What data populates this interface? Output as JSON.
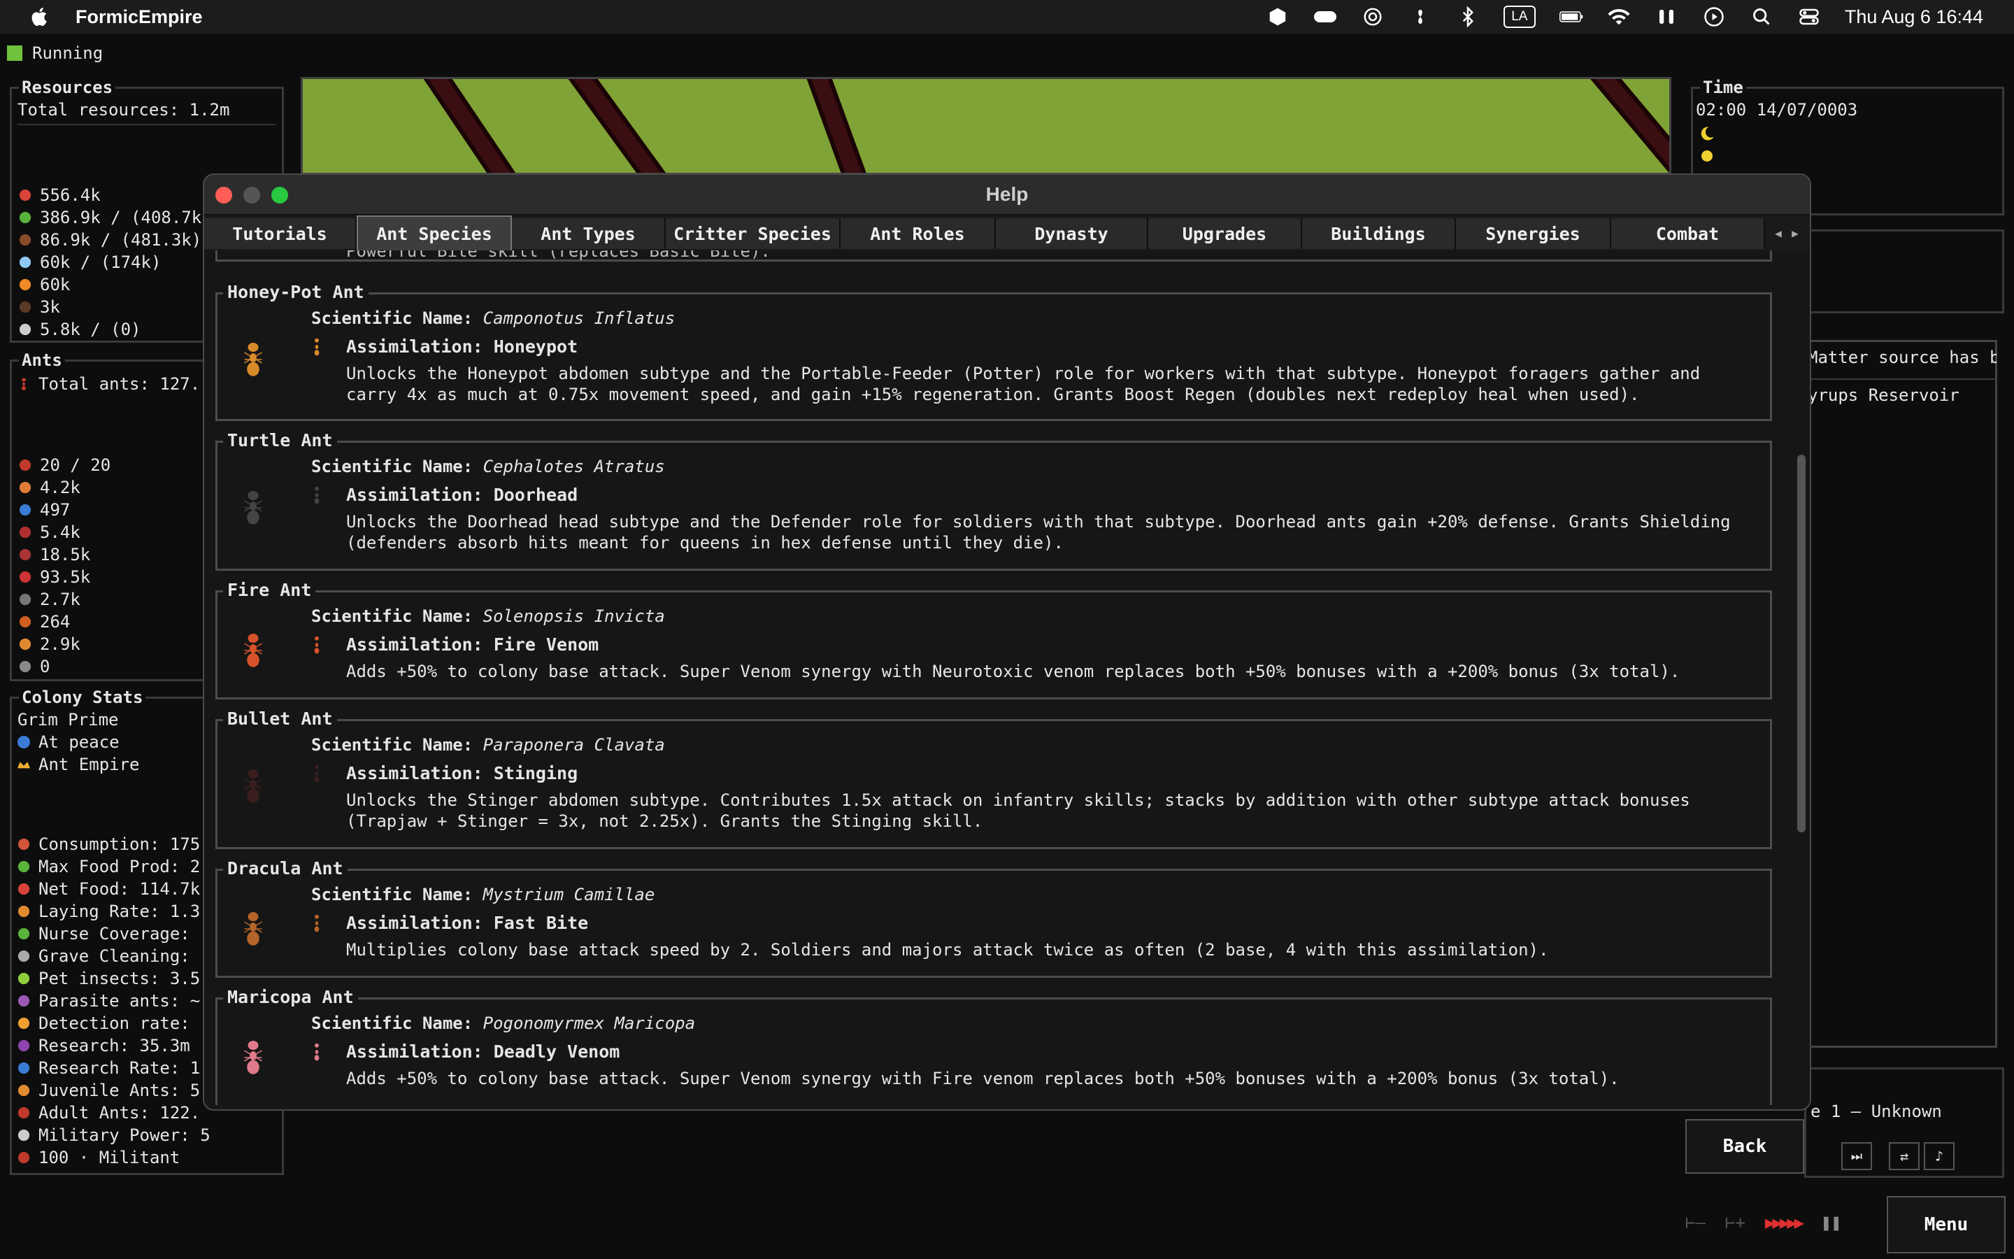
{
  "menubar": {
    "app_name": "FormicEmpire",
    "la_label": "LA",
    "datetime": "Thu Aug 6  16:44"
  },
  "status": {
    "text": "Running",
    "color": "#6fc23a"
  },
  "resources": {
    "title": "Resources",
    "total": "Total resources: 1.2m",
    "items": [
      {
        "icon": "mushroom-icon",
        "color": "#d9433a",
        "value": "556.4k"
      },
      {
        "icon": "leaf-icon",
        "color": "#59b33b",
        "value": "386.9k / (408.7k"
      },
      {
        "icon": "seed-icon",
        "color": "#8a4b2a",
        "value": "86.9k / (481.3k)"
      },
      {
        "icon": "water-icon",
        "color": "#8fc9f2",
        "value": "60k / (174k)"
      },
      {
        "icon": "orange-orb-icon",
        "color": "#f08a24",
        "value": "60k"
      },
      {
        "icon": "dirt-icon",
        "color": "#5a3a26",
        "value": "3k"
      },
      {
        "icon": "stone-icon",
        "color": "#cccccc",
        "value": "5.8k / (0)"
      }
    ]
  },
  "ants": {
    "title": "Ants",
    "total": "Total ants: 127.",
    "items": [
      {
        "icon": "queen-icon",
        "color": "#c0392b",
        "value": "20 / 20"
      },
      {
        "icon": "worker-icon",
        "color": "#e07b39",
        "value": "4.2k"
      },
      {
        "icon": "nurse-icon",
        "color": "#3a7bd5",
        "value": "497"
      },
      {
        "icon": "soldier-icon",
        "color": "#b03030",
        "value": "5.4k"
      },
      {
        "icon": "major-icon",
        "color": "#a33",
        "value": "18.5k"
      },
      {
        "icon": "forager-icon",
        "color": "#c33",
        "value": "93.5k"
      },
      {
        "icon": "scout-icon",
        "color": "#777",
        "value": "2.7k"
      },
      {
        "icon": "drone-icon",
        "color": "#d06020",
        "value": "264"
      },
      {
        "icon": "larva-icon",
        "color": "#e08a30",
        "value": "2.9k"
      },
      {
        "icon": "egg-icon",
        "color": "#888",
        "value": "0"
      }
    ]
  },
  "colony": {
    "title": "Colony Stats",
    "name": "Grim Prime",
    "peace": "At peace",
    "empire": "Ant Empire",
    "stats": [
      {
        "icon": "consumption-icon",
        "color": "#d0533a",
        "text": "Consumption: 175"
      },
      {
        "icon": "max-food-icon",
        "color": "#59b33b",
        "text": "Max Food Prod: 2"
      },
      {
        "icon": "net-food-icon",
        "color": "#d9433a",
        "text": "Net Food: 114.7k"
      },
      {
        "icon": "laying-icon",
        "color": "#e08a30",
        "text": "Laying Rate: 1.3"
      },
      {
        "icon": "nurse-plus-icon",
        "color": "#59b33b",
        "text": "Nurse Coverage: "
      },
      {
        "icon": "grave-icon",
        "color": "#aaaaaa",
        "text": "Grave Cleaning: "
      },
      {
        "icon": "pet-icon",
        "color": "#8fcf3a",
        "text": "Pet insects: 3.5"
      },
      {
        "icon": "parasite-icon",
        "color": "#9b59b6",
        "text": "Parasite ants: ~"
      },
      {
        "icon": "detection-icon",
        "color": "#f0a030",
        "text": "Detection rate: "
      },
      {
        "icon": "research-icon",
        "color": "#8e44ad",
        "text": "Research: 35.3m"
      },
      {
        "icon": "research-rate-icon",
        "color": "#3a7bd5",
        "text": "Research Rate: 1"
      },
      {
        "icon": "juvenile-icon",
        "color": "#e08a30",
        "text": "Juvenile Ants: 5"
      },
      {
        "icon": "adult-icon",
        "color": "#c0392b",
        "text": "Adult Ants: 122."
      },
      {
        "icon": "swords-icon",
        "color": "#cccccc",
        "text": "Military Power: 5"
      },
      {
        "icon": "militant-icon",
        "color": "#c0392b",
        "text": "100 · Militant"
      }
    ]
  },
  "time": {
    "title": "Time",
    "clock": "02:00 14/07/0003"
  },
  "side_log": {
    "line1": "Matter source has b",
    "line2": "yrups Reservoir"
  },
  "side_bottom": {
    "text": "e 1 — Unknown"
  },
  "help": {
    "title": "Help",
    "tabs": [
      "Tutorials",
      "Ant Species",
      "Ant Types",
      "Critter Species",
      "Ant Roles",
      "Dynasty",
      "Upgrades",
      "Buildings",
      "Synergies",
      "Combat"
    ],
    "active_tab": "Ant Species",
    "clipped_text": "Powerful Bite skill (replaces Basic Bite).",
    "sci_label": "Scientific Name: ",
    "species": [
      {
        "name": "Honey-Pot Ant",
        "scientific": "Camponotus Inflatus",
        "assimilation": "Assimilation: Honeypot",
        "desc": "Unlocks the Honeypot abdomen subtype and the Portable-Feeder (Potter) role for workers with that subtype. Honeypot foragers gather and carry 4x as much at 0.75x movement speed, and gain +15% regeneration. Grants Boost Regen (doubles next redeploy heal when used).",
        "color": "#d98a2a"
      },
      {
        "name": "Turtle Ant",
        "scientific": "Cephalotes Atratus",
        "assimilation": "Assimilation: Doorhead",
        "desc": "Unlocks the Doorhead head subtype and the Defender role for soldiers with that subtype. Doorhead ants gain +20% defense. Grants Shielding (defenders absorb hits meant for queens in hex defense until they die).",
        "color": "#444444"
      },
      {
        "name": "Fire Ant",
        "scientific": "Solenopsis Invicta",
        "assimilation": "Assimilation: Fire Venom",
        "desc": "Adds +50% to colony base attack. Super Venom synergy with Neurotoxic venom replaces both +50% bonuses with a +200% bonus (3x total).",
        "color": "#d9532a"
      },
      {
        "name": "Bullet Ant",
        "scientific": "Paraponera Clavata",
        "assimilation": "Assimilation: Stinging",
        "desc": "Unlocks the Stinger abdomen subtype. Contributes 1.5x attack on infantry skills; stacks by addition with other subtype attack bonuses (Trapjaw + Stinger = 3x, not 2.25x). Grants the Stinging skill.",
        "color": "#3a1e1e"
      },
      {
        "name": "Dracula Ant",
        "scientific": "Mystrium Camillae",
        "assimilation": "Assimilation: Fast Bite",
        "desc": "Multiplies colony base attack speed by 2. Soldiers and majors attack twice as often (2 base, 4 with this assimilation).",
        "color": "#b5642a"
      },
      {
        "name": "Maricopa Ant",
        "scientific": "Pogonomyrmex Maricopa",
        "assimilation": "Assimilation: Deadly Venom",
        "desc": "Adds +50% to colony base attack. Super Venom synergy with Fire venom replaces both +50% bonuses with a +200% bonus (3x total).",
        "color": "#e07a8a"
      }
    ],
    "back_label": "Back"
  },
  "bottom": {
    "menu_label": "Menu"
  }
}
